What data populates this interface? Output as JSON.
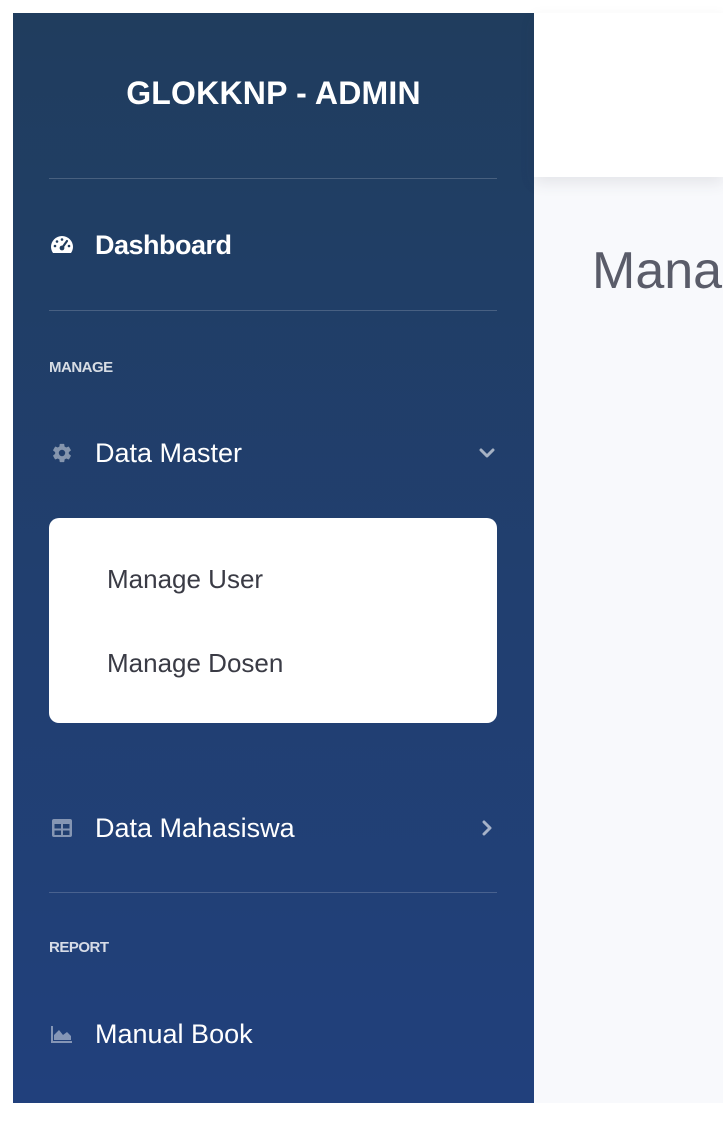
{
  "sidebar": {
    "brand": "GLOKKNP - ADMIN",
    "dashboard_label": "Dashboard",
    "sections": {
      "manage": "MANAGE",
      "report": "REPORT"
    },
    "data_master_label": "Data Master",
    "data_master_submenu": [
      {
        "label": "Manage User"
      },
      {
        "label": "Manage Dosen"
      }
    ],
    "data_mahasiswa_label": "Data Mahasiswa",
    "manual_book_label": "Manual Book",
    "icons": {
      "dashboard": "tachometer-icon",
      "data_master": "gear-icon",
      "data_master_chevron": "chevron-down-icon",
      "data_mahasiswa": "table-icon",
      "data_mahasiswa_chevron": "chevron-right-icon",
      "manual_book": "area-chart-icon"
    }
  },
  "main": {
    "page_title": "Manage User"
  },
  "colors": {
    "sidebar_top": "#203d5e",
    "sidebar_bottom": "#21407c",
    "content_bg": "#f8f9fc",
    "title_text": "#5a5c69"
  }
}
